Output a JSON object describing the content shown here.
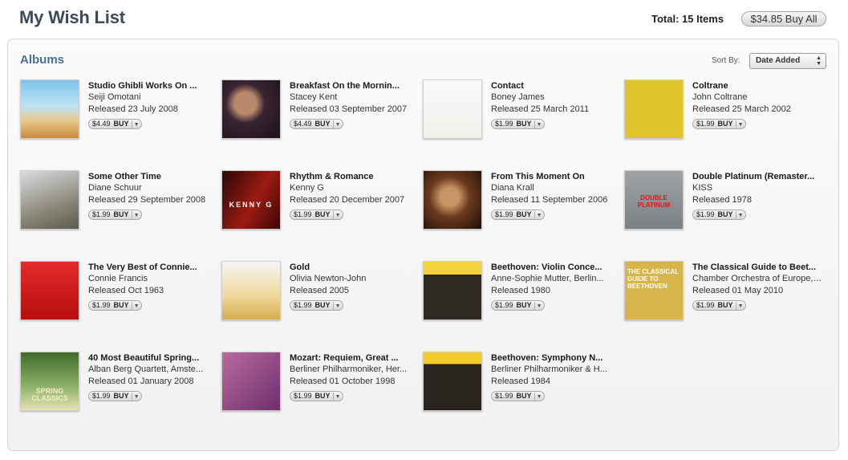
{
  "header": {
    "title": "My Wish List",
    "total_label": "Total:",
    "total_count": "15 Items",
    "buy_all": "$34.85 Buy All"
  },
  "section": {
    "title": "Albums",
    "sort_label": "Sort By:",
    "sort_value": "Date Added"
  },
  "buy_label": "BUY",
  "items": [
    {
      "title": "Studio Ghibli Works On ...",
      "artist": "Seiji Omotani",
      "released": "Released 23 July 2008",
      "price": "$4.49"
    },
    {
      "title": "Breakfast On the Mornin...",
      "artist": "Stacey Kent",
      "released": "Released 03 September 2007",
      "price": "$4.49"
    },
    {
      "title": "Contact",
      "artist": "Boney James",
      "released": "Released 25 March 2011",
      "price": "$1.99"
    },
    {
      "title": "Coltrane",
      "artist": "John Coltrane",
      "released": "Released 25 March 2002",
      "price": "$1.99"
    },
    {
      "title": "Some Other Time",
      "artist": "Diane Schuur",
      "released": "Released 29 September 2008",
      "price": "$1.99"
    },
    {
      "title": "Rhythm & Romance",
      "artist": "Kenny G",
      "released": "Released 20 December 2007",
      "price": "$1.99"
    },
    {
      "title": "From This Moment On",
      "artist": "Diana Krall",
      "released": "Released 11 September 2006",
      "price": "$1.99"
    },
    {
      "title": "Double Platinum (Remaster...",
      "artist": "KISS",
      "released": "Released 1978",
      "price": "$1.99"
    },
    {
      "title": "The Very Best of Connie...",
      "artist": "Connie Francis",
      "released": "Released Oct 1963",
      "price": "$1.99"
    },
    {
      "title": "Gold",
      "artist": "Olivia Newton-John",
      "released": "Released 2005",
      "price": "$1.99"
    },
    {
      "title": "Beethoven: Violin Conce...",
      "artist": "Anne-Sophie Mutter, Berlin...",
      "released": "Released 1980",
      "price": "$1.99"
    },
    {
      "title": "The Classical Guide to Beet...",
      "artist": "Chamber Orchestra of Europe, ...",
      "released": "Released 01 May 2010",
      "price": "$1.99"
    },
    {
      "title": "40 Most Beautiful Spring...",
      "artist": "Alban Berg Quartett, Amste...",
      "released": "Released 01 January 2008",
      "price": "$1.99"
    },
    {
      "title": "Mozart: Requiem, Great ...",
      "artist": "Berliner Philharmoniker, Her...",
      "released": "Released 01 October 1998",
      "price": "$1.99"
    },
    {
      "title": "Beethoven: Symphony N...",
      "artist": "Berliner Philharmoniker & H...",
      "released": "Released 1984",
      "price": "$1.99"
    }
  ],
  "cover_text": {
    "kenny": "KENNY G",
    "kiss": "DOUBLE PLATINUM",
    "beethoven_guide": "THE CLASSICAL GUIDE TO BEETHOVEN",
    "spring": "SPRING CLASSICS"
  }
}
